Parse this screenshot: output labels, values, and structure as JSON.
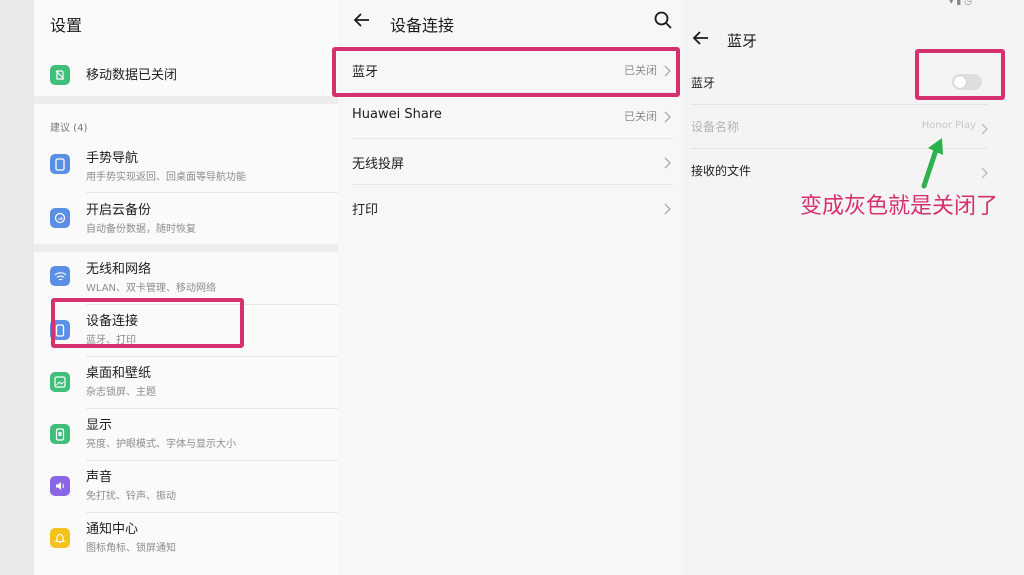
{
  "colors": {
    "highlight": "#d6316f",
    "arrow": "#2bb24c",
    "icon_blue": "#5b8fe6",
    "icon_green": "#3fbf7a",
    "icon_purple": "#8a66e6",
    "icon_yellow": "#f3c21c"
  },
  "settings": {
    "title": "设置",
    "mobile_data": "移动数据已关闭",
    "suggestions_label": "建议 (4)",
    "items": [
      {
        "icon": "gesture-nav-icon",
        "title": "手势导航",
        "subtitle": "用手势实现返回、回桌面等导航功能"
      },
      {
        "icon": "cloud-backup-icon",
        "title": "开启云备份",
        "subtitle": "自动备份数据，随时恢复"
      },
      {
        "icon": "wifi-icon",
        "title": "无线和网络",
        "subtitle": "WLAN、双卡管理、移动网络"
      },
      {
        "icon": "device-connection-icon",
        "title": "设备连接",
        "subtitle": "蓝牙、打印"
      },
      {
        "icon": "wallpaper-icon",
        "title": "桌面和壁纸",
        "subtitle": "杂志锁屏、主题"
      },
      {
        "icon": "display-icon",
        "title": "显示",
        "subtitle": "亮度、护眼模式、字体与显示大小"
      },
      {
        "icon": "sound-icon",
        "title": "声音",
        "subtitle": "免打扰、铃声、振动"
      },
      {
        "icon": "notification-icon",
        "title": "通知中心",
        "subtitle": "图标角标、锁屏通知"
      }
    ]
  },
  "device_connection": {
    "title": "设备连接",
    "rows": [
      {
        "label": "蓝牙",
        "value": "已关闭"
      },
      {
        "label": "Huawei Share",
        "value": "已关闭"
      },
      {
        "label": "无线投屏",
        "value": ""
      },
      {
        "label": "打印",
        "value": ""
      }
    ]
  },
  "bluetooth": {
    "title": "蓝牙",
    "toggle_label": "蓝牙",
    "toggle_on": false,
    "device_name_label": "设备名称",
    "device_name_value": "Honor Play",
    "received_files_label": "接收的文件"
  },
  "annotation": "变成灰色就是关闭了"
}
